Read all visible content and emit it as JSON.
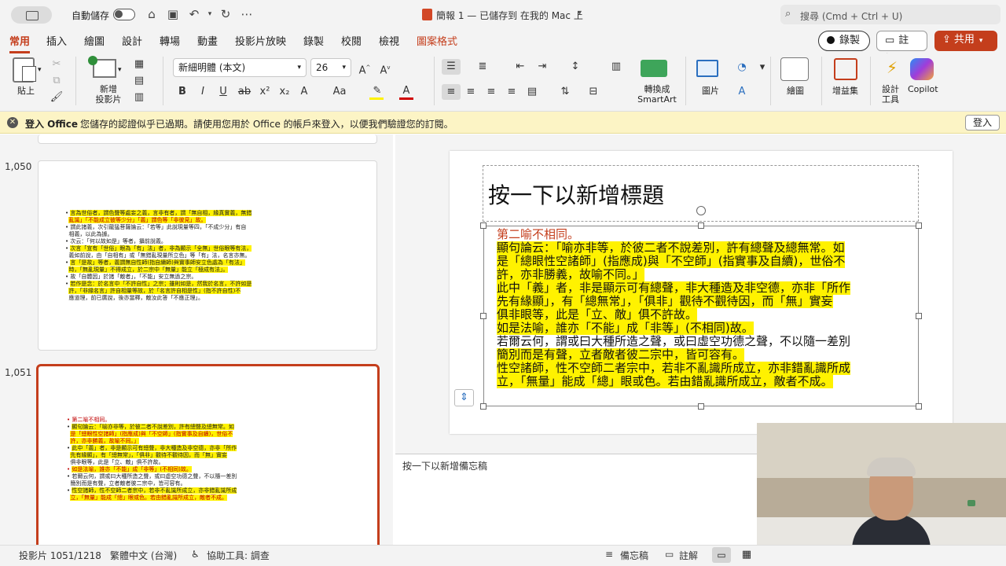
{
  "titlebar": {
    "autosave_label": "自動儲存",
    "document_title": "簡報 1 — 已儲存到 在我的 Mac 上",
    "search_placeholder": "搜尋 (Cmd + Ctrl + U)"
  },
  "tabs": [
    "常用",
    "插入",
    "繪圖",
    "設計",
    "轉場",
    "動畫",
    "投影片放映",
    "錄製",
    "校閱",
    "檢視",
    "圖案格式"
  ],
  "right_buttons": {
    "record": "錄製",
    "comments": "註解",
    "share": "共用"
  },
  "ribbon": {
    "paste": "貼上",
    "new_slide": "新增\n投影片",
    "font_name": "新細明體 (本文)",
    "font_size": "26",
    "convert_smartart": "轉換成\nSmartArt",
    "picture": "圖片",
    "draw": "繪圖",
    "addins": "增益集",
    "design_tools": "設計\n工具",
    "copilot": "Copilot"
  },
  "infobar": {
    "title": "登入 Office",
    "message": "您儲存的認證似乎已過期。請使用您用於 Office 的帳戶來登入，以便我們驗證您的訂閱。",
    "button": "登入"
  },
  "thumbnails": [
    {
      "number": "1,050",
      "lines": [
        "言為世俗者，謂色聲等處妄之義，言非有者，謂「無自相，緣真實義，無錯",
        "亂識」「不能成立彼等少分」「義」謂色等「非彼見」故。",
        "謂此諸義，次引龍猛菩薩論云：「若等」此說現量等四，「不成少分」有自",
        "相義，以此為據。",
        "次云：「何以故如是」等者，攝前說義。",
        "次言「宣有「世俗」眼為「有」法」者，非為顯示「全無」世俗眼等有法，",
        "義如前說，由「自相有」或「無錯亂現量所立色」等「有」法，名言亦無。",
        "言「是故」等者，義謂無自性師(指自續師)與實事師安立色處為「有法」",
        "時，「無亂現量」不得成立，於二宗中「無量」能立「極成有法」。",
        "故「自體因」於諸「敵者」，「不能」安立無過之宗。",
        "若作是念：於名言中「不許自性」之宗；雖則如是，然我於名言，不許如是",
        "許，「非緣名言」許自相量等故，於「名言許自相是性」(指不許自性)不",
        "應道理，前已廣說，後亦當釋，敵汝此答「不應正理」。"
      ]
    },
    {
      "number": "1,051",
      "lines": [
        "第二喻不相同。",
        "顯句論云：「喻亦非等，於彼二者不說差別，許有總聲及總無常。如",
        "是「總眼性空諸師」(指應成)與「不空師」(指實事及自續)，世俗不",
        "許，亦非勝義，故喻不同。」",
        "此中「義」者，非是顯示可有總聲，非大種造及非空德，亦非「所作",
        "先有緣顯」，有「總無常」，「俱非」觀待不觀待因，而「無」實妄",
        "俱非眼等，此是「立、敵」俱不許故。",
        "如是法喻，誰亦「不能」成「非等」(不相同)故。",
        "若爾云何，謂或曰大種所造之聲，或曰虛空功德之聲，不以隨一差別",
        "簡別而是有聲，立者敵者彼二宗中，皆可容有。",
        "性空諸師，性不空師二者宗中，若非不亂識所成立，亦非錯亂識所成",
        "立，「無量」能成「總」眼或色。若由錯亂識所成立，敵者不成。"
      ]
    }
  ],
  "slide": {
    "title_placeholder": "按一下以新增標題",
    "lines": [
      "第二喻不相同。",
      "顯句論云：「喻亦非等，於彼二者不說差別，許有總聲及總無常。如",
      "是「總眼性空諸師」(指應成)與「不空師」(指實事及自續)，世俗不",
      "許，亦非勝義，故喻不同。」",
      "此中「義」者，非是顯示可有總聲，非大種造及非空德，亦非「所作",
      "先有緣顯」，有「總無常」，「俱非」觀待不觀待因，而「無」實妄",
      "俱非眼等，此是「立、敵」俱不許故。",
      "如是法喻，誰亦「不能」成「非等」(不相同)故。",
      "若爾云何，謂或曰大種所造之聲，或曰虛空功德之聲，不以隨一差別",
      "簡別而是有聲，立者敵者彼二宗中，皆可容有。",
      "性空諸師，性不空師二者宗中，若非不亂識所成立，亦非錯亂識所成",
      "立，「無量」能成「總」眼或色。若由錯亂識所成立，敵者不成。"
    ]
  },
  "notes_placeholder": "按一下以新增備忘稿",
  "status": {
    "slide_position": "投影片 1051/1218",
    "language": "繁體中文 (台灣)",
    "accessibility": "協助工具: 調查",
    "notes_button": "備忘稿",
    "comments_button": "註解"
  },
  "colors": {
    "accent": "#c43e1c",
    "highlight": "#fff200",
    "red_text": "#c00000",
    "infobar": "#fcf4c5"
  }
}
